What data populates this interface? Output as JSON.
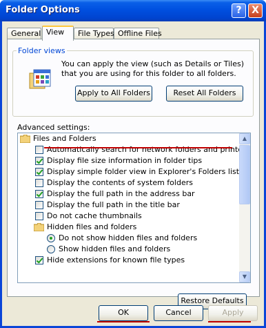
{
  "title_bar": {
    "title": "Folder Options",
    "help_label": "?",
    "close_label": "X"
  },
  "tabs": [
    {
      "label": "General",
      "active": false
    },
    {
      "label": "View",
      "active": true
    },
    {
      "label": "File Types",
      "active": false
    },
    {
      "label": "Offline Files",
      "active": false
    }
  ],
  "folder_views": {
    "group_label": "Folder views",
    "description": "You can apply the view (such as Details or Tiles) that you are using for this folder to all folders.",
    "apply_button": "Apply to All Folders",
    "reset_button": "Reset All Folders"
  },
  "advanced": {
    "label": "Advanced settings:",
    "items": [
      {
        "kind": "folder",
        "label": "Files and Folders",
        "level": 0
      },
      {
        "kind": "checkbox",
        "label": "Automatically search for network folders and printers",
        "checked": false,
        "level": 1
      },
      {
        "kind": "checkbox",
        "label": "Display file size information in folder tips",
        "checked": true,
        "level": 1
      },
      {
        "kind": "checkbox",
        "label": "Display simple folder view in Explorer's Folders list",
        "checked": true,
        "level": 1
      },
      {
        "kind": "checkbox",
        "label": "Display the contents of system folders",
        "checked": false,
        "level": 1
      },
      {
        "kind": "checkbox",
        "label": "Display the full path in the address bar",
        "checked": true,
        "level": 1
      },
      {
        "kind": "checkbox",
        "label": "Display the full path in the title bar",
        "checked": false,
        "level": 1
      },
      {
        "kind": "checkbox",
        "label": "Do not cache thumbnails",
        "checked": false,
        "level": 1
      },
      {
        "kind": "folder",
        "label": "Hidden files and folders",
        "level": 1
      },
      {
        "kind": "radio",
        "label": "Do not show hidden files and folders",
        "checked": true,
        "level": 2
      },
      {
        "kind": "radio",
        "label": "Show hidden files and folders",
        "checked": false,
        "level": 2
      },
      {
        "kind": "checkbox",
        "label": "Hide extensions for known file types",
        "checked": true,
        "level": 1
      }
    ],
    "restore_button": "Restore Defaults"
  },
  "footer": {
    "ok": "OK",
    "cancel": "Cancel",
    "apply": "Apply"
  },
  "colors": {
    "annotation_red": "#c00000",
    "accent_blue": "#0046d5",
    "title_blue": "#0050e0"
  }
}
